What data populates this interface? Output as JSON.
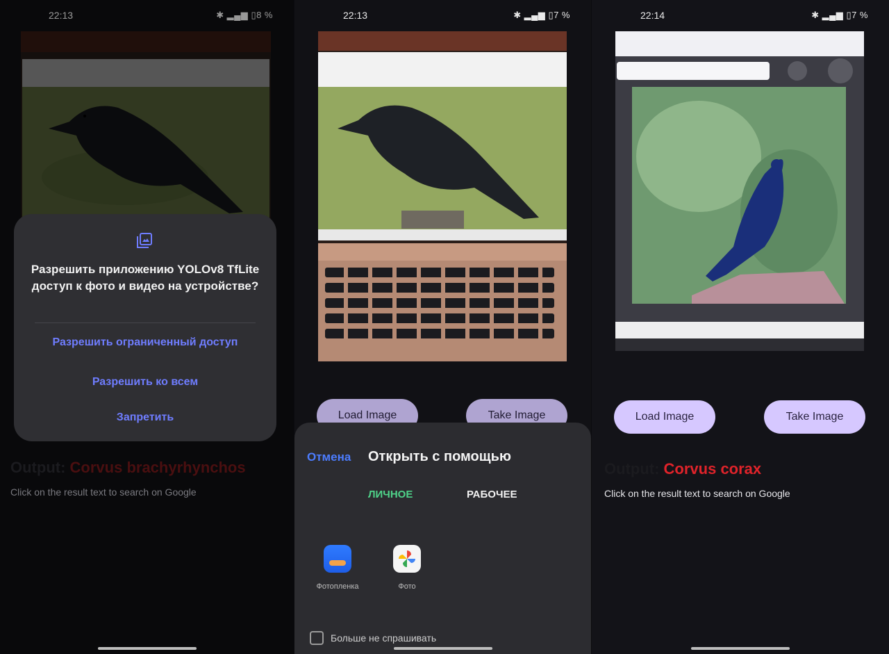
{
  "screens": [
    {
      "status": {
        "time": "22:13",
        "battery": "8 %"
      },
      "dialog": {
        "title": "Разрешить приложению YOLOv8 TfLite доступ к фото и видео на устройстве?",
        "options": [
          "Разрешить ограниченный доступ",
          "Разрешить ко всем",
          "Запретить"
        ]
      },
      "output_label": "Output:",
      "output_value": "Corvus brachyrhynchos",
      "hint": "Click on the result text to search on Google"
    },
    {
      "status": {
        "time": "22:13",
        "battery": "7 %"
      },
      "buttons": {
        "load": "Load Image",
        "take": "Take Image"
      },
      "sheet": {
        "cancel": "Отмена",
        "title": "Открыть с помощью",
        "tabs": [
          "ЛИЧНОЕ",
          "РАБОЧЕЕ"
        ],
        "apps": [
          "Фотопленка",
          "Фото"
        ],
        "checkbox_label": "Больше не спрашивать"
      }
    },
    {
      "status": {
        "time": "22:14",
        "battery": "7 %"
      },
      "buttons": {
        "load": "Load Image",
        "take": "Take Image"
      },
      "output_label": "Output:",
      "output_value": "Corvus corax",
      "hint": "Click on the result text to search on Google"
    }
  ],
  "colors": {
    "accent_link": "#6f7dff",
    "button_bg": "#d6c8ff",
    "result_red": "#e0232a",
    "tab_active": "#4fd48a"
  }
}
